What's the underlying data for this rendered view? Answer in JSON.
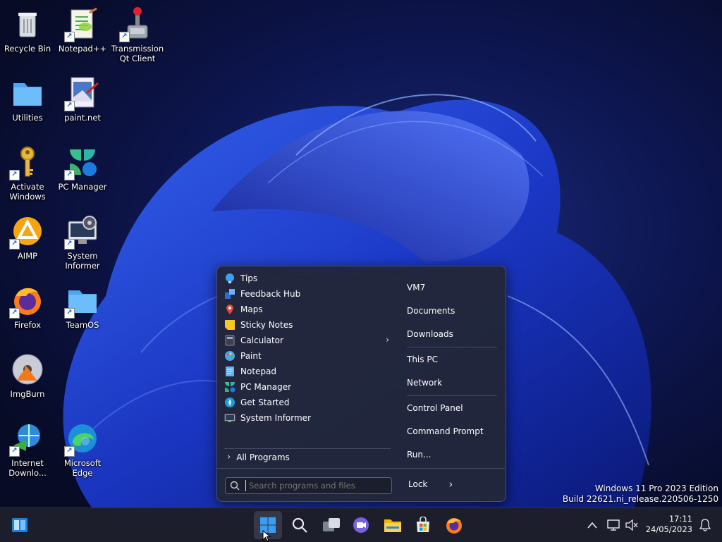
{
  "desktop": {
    "icons": [
      {
        "label": "Recycle Bin",
        "icon": "recycle-bin-icon"
      },
      {
        "label": "Notepad++",
        "icon": "notepadpp-icon"
      },
      {
        "label": "Transmission Qt Client",
        "icon": "transmission-icon"
      },
      {
        "label": "Utilities",
        "icon": "folder-icon"
      },
      {
        "label": "paint.net",
        "icon": "paintnet-icon"
      },
      {
        "label": "Activate Windows",
        "icon": "key-icon"
      },
      {
        "label": "PC Manager",
        "icon": "pc-manager-icon"
      },
      {
        "label": "AIMP",
        "icon": "aimp-icon"
      },
      {
        "label": "System Informer",
        "icon": "system-informer-icon"
      },
      {
        "label": "Firefox",
        "icon": "firefox-icon"
      },
      {
        "label": "TeamOS",
        "icon": "folder-icon"
      },
      {
        "label": "ImgBurn",
        "icon": "imgburn-icon"
      },
      {
        "label": "Internet Downlo...",
        "icon": "idm-icon"
      },
      {
        "label": "Microsoft Edge",
        "icon": "edge-icon"
      }
    ]
  },
  "watermark": {
    "line1": "Windows 11 Pro 2023 Edition",
    "line2": "Build 22621.ni_release.220506-1250"
  },
  "start_menu": {
    "programs": [
      {
        "label": "Tips",
        "icon": "tips-icon"
      },
      {
        "label": "Feedback Hub",
        "icon": "feedback-hub-icon"
      },
      {
        "label": "Maps",
        "icon": "maps-icon"
      },
      {
        "label": "Sticky Notes",
        "icon": "sticky-notes-icon"
      },
      {
        "label": "Calculator",
        "icon": "calculator-icon"
      },
      {
        "label": "Paint",
        "icon": "paint-icon"
      },
      {
        "label": "Notepad",
        "icon": "notepad-icon"
      },
      {
        "label": "PC Manager",
        "icon": "pc-manager-icon"
      },
      {
        "label": "Get Started",
        "icon": "get-started-icon"
      },
      {
        "label": "System Informer",
        "icon": "system-informer-icon"
      }
    ],
    "all_programs": "All Programs",
    "search_placeholder": "Search programs and files",
    "places": [
      "VM7",
      "Documents",
      "Downloads",
      "This PC",
      "Network",
      "Control Panel",
      "Command Prompt",
      "Run..."
    ],
    "lock_label": "Lock"
  },
  "taskbar": {
    "apps": [
      "start-icon",
      "search-icon",
      "task-view-icon",
      "chat-icon",
      "file-explorer-icon",
      "store-icon",
      "firefox-icon"
    ],
    "time": "17:11",
    "date": "24/05/2023"
  },
  "colors": {
    "accent": "#2f7fe0",
    "taskbar": "#1c1f2b",
    "menu": "#222638"
  }
}
